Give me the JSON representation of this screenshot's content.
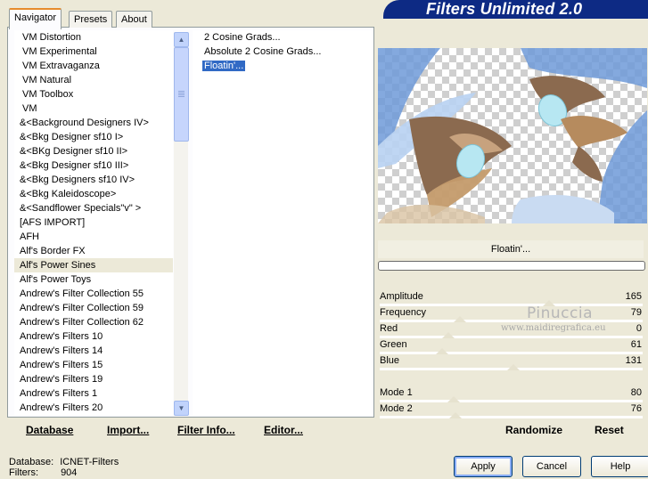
{
  "banner": {
    "title": "Filters Unlimited 2.0"
  },
  "tabs": [
    {
      "label": "Navigator",
      "active": true
    },
    {
      "label": "Presets",
      "active": false
    },
    {
      "label": "About",
      "active": false
    }
  ],
  "categories": [
    "VM Distortion",
    "VM Experimental",
    "VM Extravaganza",
    "VM Natural",
    "VM Toolbox",
    "VM",
    "&<Background Designers IV>",
    "&<Bkg Designer sf10 I>",
    "&<BKg Designer sf10 II>",
    "&<Bkg Designer sf10 III>",
    "&<Bkg Designers sf10 IV>",
    "&<Bkg Kaleidoscope>",
    "&<Sandflower Specials\"v\" >",
    "[AFS IMPORT]",
    "AFH",
    "Alf's Border FX",
    "Alf's Power Sines",
    "Alf's Power Toys",
    "Andrew's Filter Collection 55",
    "Andrew's Filter Collection 59",
    "Andrew's Filter Collection 62",
    "Andrew's Filters 10",
    "Andrew's Filters 14",
    "Andrew's Filters 15",
    "Andrew's Filters 19",
    "Andrew's Filters 1",
    "Andrew's Filters 20"
  ],
  "selected_category": "Alf's Power Sines",
  "filters": [
    "2 Cosine Grads...",
    "Absolute 2 Cosine Grads...",
    "Floatin'..."
  ],
  "selected_filter": "Floatin'...",
  "preview": {
    "filter_name": "Floatin'..."
  },
  "params": [
    {
      "label": "Amplitude",
      "value": "165"
    },
    {
      "label": "Frequency",
      "value": "79"
    },
    {
      "label": "Red",
      "value": "0"
    },
    {
      "label": "Green",
      "value": "61"
    },
    {
      "label": "Blue",
      "value": "131"
    },
    {
      "label": "Mode 1",
      "value": "80"
    },
    {
      "label": "Mode 2",
      "value": "76"
    }
  ],
  "watermark": {
    "line1": "Pinuccia",
    "line2": "www.maidiregrafica.eu"
  },
  "bottom_links": {
    "database": "Database",
    "import": "Import...",
    "filter_info": "Filter Info...",
    "editor": "Editor...",
    "randomize": "Randomize",
    "reset": "Reset"
  },
  "status": {
    "database_label": "Database:",
    "database_value": "ICNET-Filters",
    "filters_label": "Filters:",
    "filters_value": "904"
  },
  "buttons": {
    "apply": "Apply",
    "cancel": "Cancel",
    "help": "Help"
  },
  "colors": {
    "banner": "#0d2a84",
    "selection": "#316ac5",
    "tab_accent": "#e68b2c"
  }
}
